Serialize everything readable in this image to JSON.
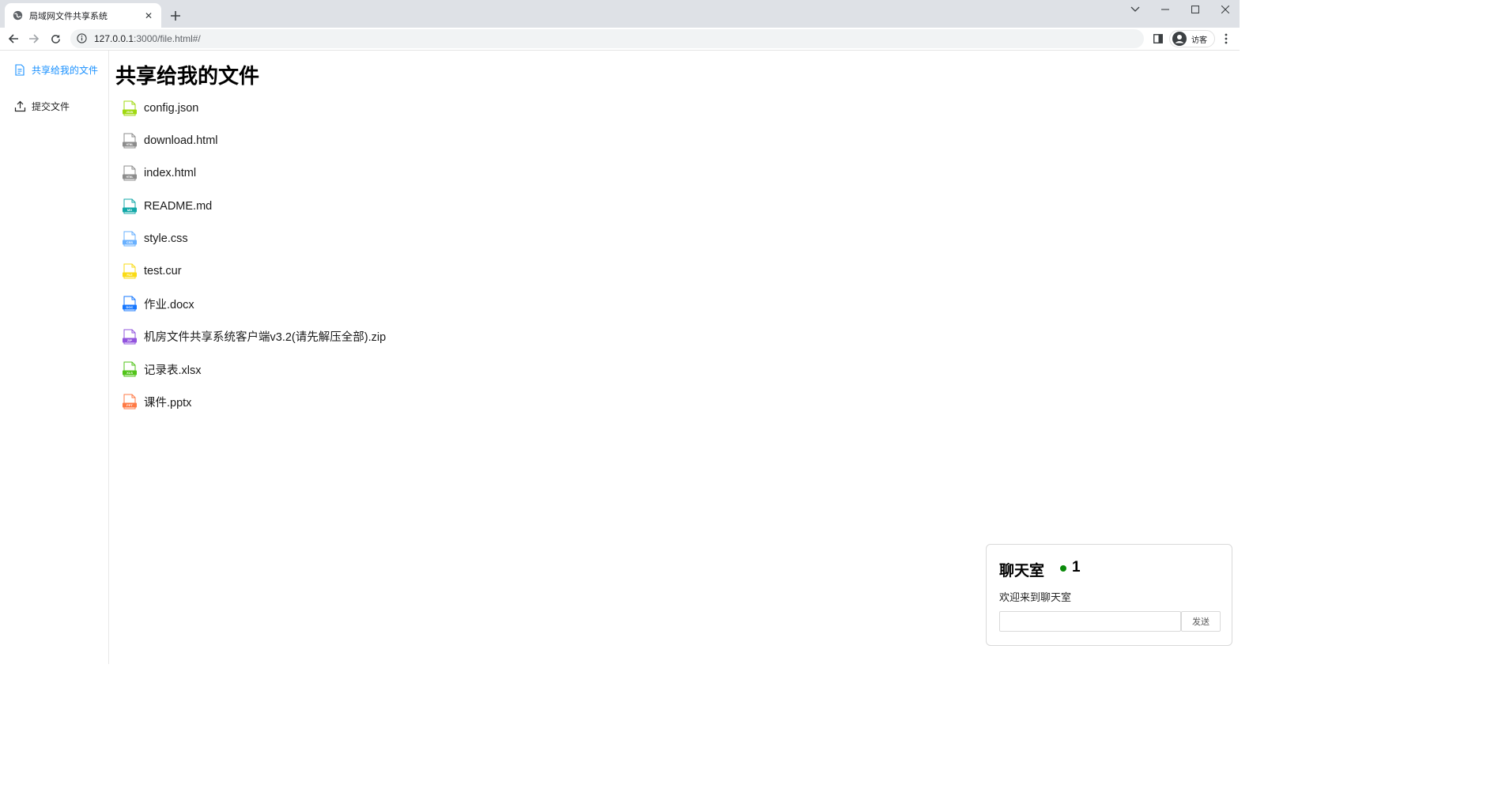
{
  "browser": {
    "tab_title": "局域网文件共享系统",
    "url_host": "127.0.0.1",
    "url_path": ":3000/file.html#/",
    "profile_label": "访客"
  },
  "sidebar": {
    "items": [
      {
        "label": "共享给我的文件",
        "icon": "document-icon",
        "active": true
      },
      {
        "label": "提交文件",
        "icon": "upload-icon",
        "active": false
      }
    ]
  },
  "main": {
    "title": "共享给我的文件",
    "files": [
      {
        "name": "config.json",
        "badge": "JSON",
        "color": "#a0d911"
      },
      {
        "name": "download.html",
        "badge": "HTML",
        "color": "#8c8c8c"
      },
      {
        "name": "index.html",
        "badge": "HTML",
        "color": "#8c8c8c"
      },
      {
        "name": "README.md",
        "badge": "MD",
        "color": "#13a8a8"
      },
      {
        "name": "style.css",
        "badge": "CSS",
        "color": "#69b1ff"
      },
      {
        "name": "test.cur",
        "badge": "FILE",
        "color": "#fadb14"
      },
      {
        "name": "作业.docx",
        "badge": "DOC",
        "color": "#1677ff"
      },
      {
        "name": "机房文件共享系统客户端v3.2(请先解压全部).zip",
        "badge": "ZIP",
        "color": "#9254de"
      },
      {
        "name": "记录表.xlsx",
        "badge": "XLS",
        "color": "#52c41a"
      },
      {
        "name": "课件.pptx",
        "badge": "PPT",
        "color": "#ff7a45"
      }
    ]
  },
  "chat": {
    "title": "聊天室",
    "online_count": "1",
    "online_color": "#0a8a0a",
    "message": "欢迎来到聊天室",
    "input_value": "",
    "send_label": "发送"
  }
}
